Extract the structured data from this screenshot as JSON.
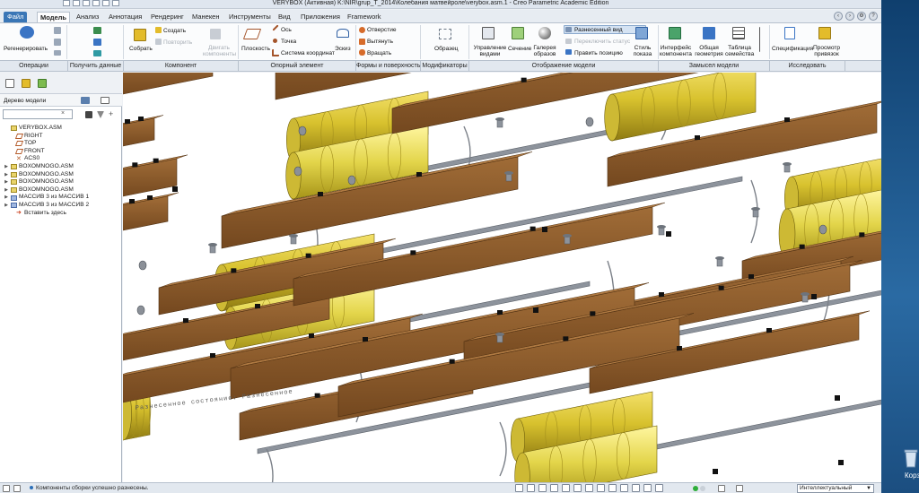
{
  "window": {
    "title": "VERYBOX (Активная) K:\\NIR\\grup_T_2014\\Колебания матвейрoле\\verybox.asm.1 - Creo Parametric Academic Edition"
  },
  "tabs": [
    {
      "label": "Файл",
      "active": false,
      "file": true
    },
    {
      "label": "Модель",
      "active": true
    },
    {
      "label": "Анализ",
      "active": false
    },
    {
      "label": "Аннотация",
      "active": false
    },
    {
      "label": "Рендеринг",
      "active": false
    },
    {
      "label": "Манекен",
      "active": false
    },
    {
      "label": "Инструменты",
      "active": false
    },
    {
      "label": "Вид",
      "active": false
    },
    {
      "label": "Приложения",
      "active": false
    },
    {
      "label": "Framework",
      "active": false
    }
  ],
  "ribbon": {
    "regenerate": "Регенерировать",
    "assemble": "Собрать",
    "create": "Создать",
    "repeat": "Повторить",
    "drag_components": "Двигать компоненты",
    "plane": "Плоскость",
    "axis": "Ось",
    "point": "Точка",
    "csys": "Система координат",
    "sketch": "Эскиз",
    "hole": "Отверстие",
    "extrude": "Вытянуть",
    "revolve": "Вращать",
    "pattern": "Образец",
    "manage_views": "Управление видами",
    "section": "Сечение",
    "appearance_gallery": "Галерея образов",
    "explode_view": "Разнесенный вид",
    "toggle_status": "Переключить статус",
    "edit_position": "Править позицию",
    "display_style": "Стиль показа",
    "component_interface": "Интерфейс компонента",
    "shared_geometry": "Общая геометрия",
    "family_table": "Таблица семейства",
    "specification": "Спецификация",
    "reference_viewer": "Просмотр привязок"
  },
  "groups": [
    "Операции",
    "Получить данные",
    "Компонент",
    "Опорный элемент",
    "Формы и поверхность",
    "Модификаторы",
    "Отображение модели",
    "Замысел модели",
    "Исследовать"
  ],
  "model_tree": {
    "header": "Дерево модели",
    "items": [
      {
        "label": "VERYBOX.ASM",
        "icon": "assembly-icon",
        "expand": ""
      },
      {
        "label": "RIGHT",
        "icon": "datum-plane-icon",
        "expand": ""
      },
      {
        "label": "TOP",
        "icon": "datum-plane-icon",
        "expand": ""
      },
      {
        "label": "FRONT",
        "icon": "datum-plane-icon",
        "expand": ""
      },
      {
        "label": "ACS0",
        "icon": "csys-icon",
        "expand": ""
      },
      {
        "label": "BOXOMNOGO.ASM",
        "icon": "assembly-icon",
        "expand": "▶"
      },
      {
        "label": "BOXOMNOGO.ASM",
        "icon": "assembly-icon",
        "expand": "▶"
      },
      {
        "label": "BOXOMNOGO.ASM",
        "icon": "assembly-icon",
        "expand": "▶"
      },
      {
        "label": "BOXOMNOGO.ASM",
        "icon": "assembly-icon",
        "expand": "▶"
      },
      {
        "label": "МАССИВ 3 из МАССИВ 1",
        "icon": "pattern-icon",
        "expand": "▶"
      },
      {
        "label": "МАССИВ 3 из МАССИВ 2",
        "icon": "pattern-icon",
        "expand": "▶"
      },
      {
        "label": "Вставить здесь",
        "icon": "insert-here-icon",
        "expand": ""
      }
    ]
  },
  "viewport": {
    "watermark": "Разнесенное состояние: Разнесенное"
  },
  "status": {
    "message": "Компоненты сборки успешно разнесены.",
    "filter": "Интеллектуальный"
  },
  "desktop": {
    "recycle_label": "Корзина"
  },
  "colors": {
    "beam": "#8a5a2b",
    "barrel": "#d8c22e",
    "rail": "#8d939c",
    "file_tab": "#3a76b6"
  }
}
